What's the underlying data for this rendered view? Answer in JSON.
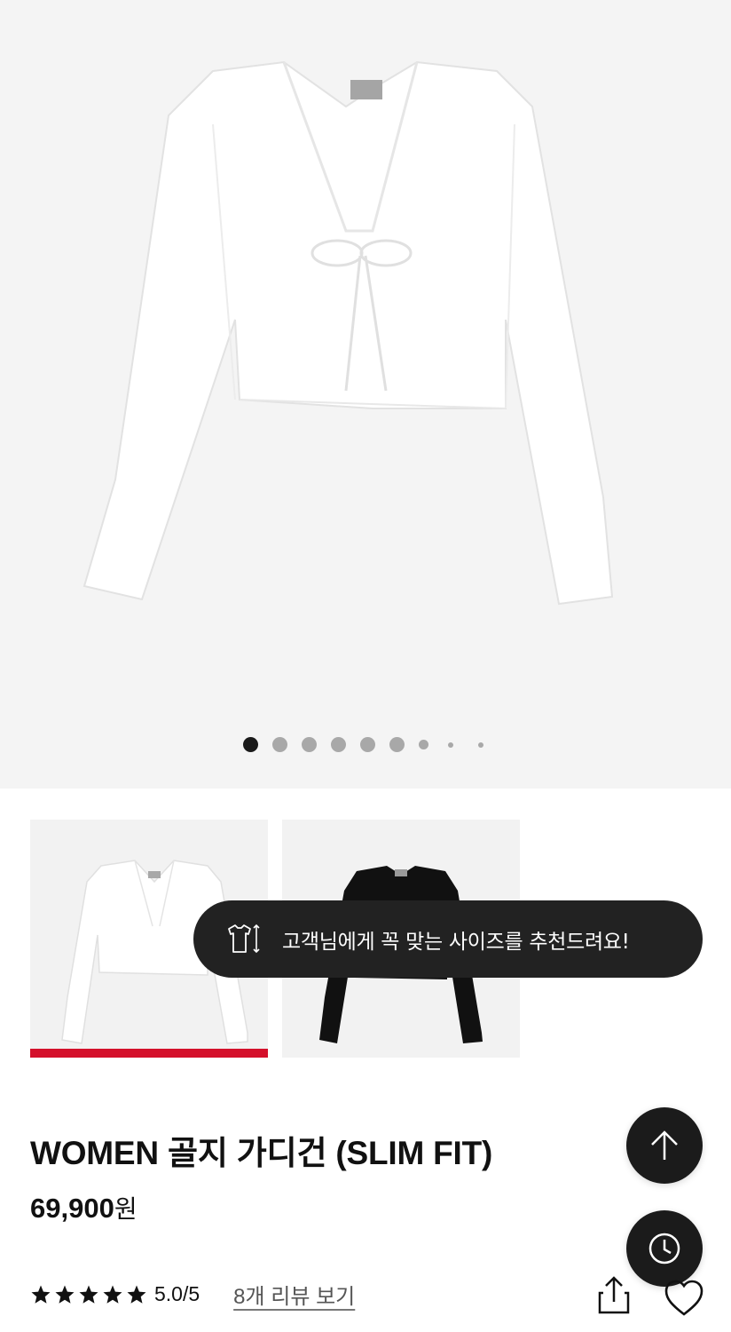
{
  "gallery": {
    "image_alt": "white tie-front cropped cardigan",
    "dots_total": 9,
    "active_index": 0
  },
  "thumbnails": [
    {
      "name": "white",
      "selected": true
    },
    {
      "name": "black",
      "selected": false
    }
  ],
  "size_toast": {
    "icon": "tshirt-size-icon",
    "text": "고객님에게 꼭 맞는 사이즈를 추천드려요!"
  },
  "product": {
    "title": "WOMEN 골지 가디건 (SLIM FIT)",
    "price": "69,900",
    "currency": "원"
  },
  "rating": {
    "stars": 5,
    "value": "5.0/5",
    "review_link": "8개 리뷰 보기"
  },
  "actions": {
    "scroll_top_icon": "arrow-up-icon",
    "recent_icon": "clock-icon",
    "share_icon": "share-icon",
    "wish_icon": "heart-icon"
  },
  "colors": {
    "accent": "#d4102b",
    "dark": "#222222",
    "hero_bg": "#f4f4f4"
  }
}
